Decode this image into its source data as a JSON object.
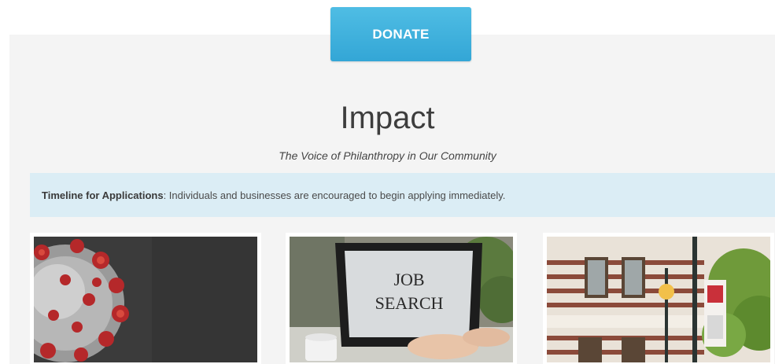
{
  "donate": {
    "label": "DONATE"
  },
  "header": {
    "title": "Impact",
    "subtitle": "The Voice of Philanthropy in Our Community"
  },
  "notice": {
    "label": "Timeline for Applications",
    "text": ": Individuals and businesses are encouraged to begin applying immediately."
  },
  "cards": [
    {
      "image": "coronavirus-image"
    },
    {
      "image": "job-search-laptop-image",
      "screen_text_line1": "JOB",
      "screen_text_line2": "SEARCH"
    },
    {
      "image": "main-street-building-image"
    }
  ],
  "colors": {
    "accent": "#3fb0de",
    "notice_bg": "#dbedf5",
    "panel_bg": "#f4f4f4"
  }
}
